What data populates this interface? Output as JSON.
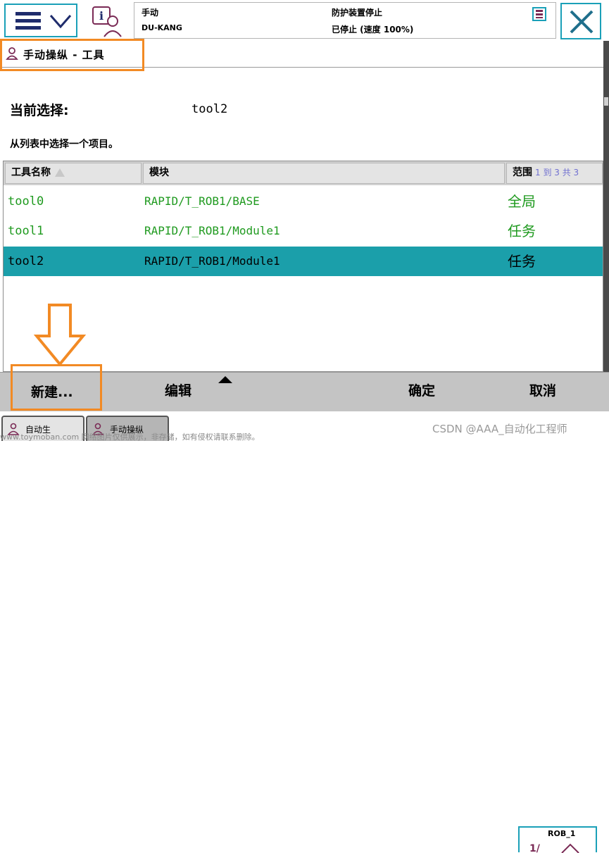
{
  "status": {
    "mode": "手动",
    "controller": "DU-KANG",
    "safety": "防护装置停止",
    "run_state": "已停止 (速度 100%)"
  },
  "window": {
    "title": "手动操纵 - 工具"
  },
  "current_selection": {
    "label": "当前选择:",
    "value": "tool2"
  },
  "instruction": "从列表中选择一个项目。",
  "table": {
    "headers": {
      "name": "工具名称",
      "module": "模块",
      "range": "范围",
      "range_count": "1 到 3 共 3"
    },
    "rows": [
      {
        "name": "tool0",
        "module": "RAPID/T_ROB1/BASE",
        "range": "全局",
        "selected": false
      },
      {
        "name": "tool1",
        "module": "RAPID/T_ROB1/Module1",
        "range": "任务",
        "selected": false
      },
      {
        "name": "tool2",
        "module": "RAPID/T_ROB1/Module1",
        "range": "任务",
        "selected": true
      }
    ]
  },
  "commands": {
    "new": "新建...",
    "edit": "编辑",
    "ok": "确定",
    "cancel": "取消"
  },
  "taskbar": {
    "task1": "自动生",
    "task2": "手动操纵",
    "robot": "ROB_1",
    "watermark": "www.toymoban.com 网络图片仅供展示，非存储，如有侵权请联系删除。",
    "csdn": "CSDN @AAA_自动化工程师"
  },
  "colors": {
    "accent_border": "#1aa0b8",
    "highlight_orange": "#f28a24",
    "selected_row": "#1b9faa",
    "row_text": "#1f9a1f"
  }
}
